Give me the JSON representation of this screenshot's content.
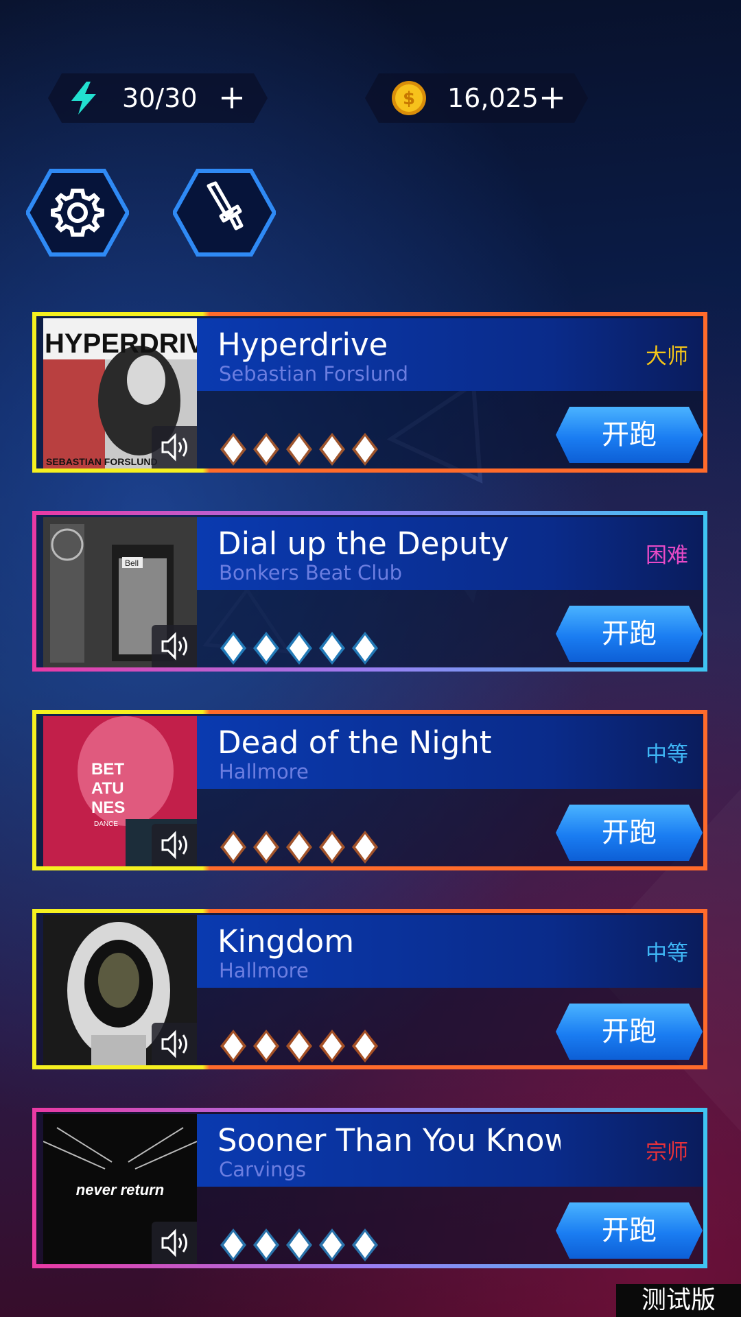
{
  "hud": {
    "energy": {
      "icon": "lightning-icon",
      "value": "30/30",
      "plus": "+"
    },
    "coins": {
      "icon": "coin-icon",
      "value": "16,025",
      "plus": "+"
    }
  },
  "toolbar": {
    "settings_icon": "gear-icon",
    "equipment_icon": "sword-icon"
  },
  "songs": [
    {
      "title": "Hyperdrive",
      "artist": "Sebastian Forslund",
      "difficulty": "大师",
      "difficulty_color": "#f5c518",
      "diamonds": 5,
      "diamond_style": "orange",
      "play_label": "开跑",
      "cover_text": "HYPERDRIVE",
      "cover_sub": "SEBASTIAN FORSLUND"
    },
    {
      "title": "Dial up the Deputy",
      "artist": "Bonkers Beat Club",
      "difficulty": "困难",
      "difficulty_color": "#e84ac6",
      "diamonds": 5,
      "diamond_style": "blue",
      "play_label": "开跑",
      "cover_text": "Bell"
    },
    {
      "title": "Dead of the Night",
      "artist": "Hallmore",
      "difficulty": "中等",
      "difficulty_color": "#3fb6f5",
      "diamonds": 5,
      "diamond_style": "orange",
      "play_label": "开跑",
      "cover_text": "BET ATU NES",
      "cover_sub": "DANCE"
    },
    {
      "title": "Kingdom",
      "artist": "Hallmore",
      "difficulty": "中等",
      "difficulty_color": "#3fb6f5",
      "diamonds": 5,
      "diamond_style": "orange",
      "play_label": "开跑"
    },
    {
      "title": "Sooner Than You Know",
      "artist": "Carvings",
      "difficulty": "宗师",
      "difficulty_color": "#e8313a",
      "diamonds": 5,
      "diamond_style": "blue",
      "play_label": "开跑",
      "cover_text": "never return"
    }
  ],
  "badge": "测试版",
  "colors": {
    "accent_blue": "#1a7df2",
    "frame_orange": "#ff6b2b",
    "frame_yellow": "#f5f020",
    "frame_pink": "#e93aa4",
    "frame_cyan": "#3fc4f2"
  }
}
